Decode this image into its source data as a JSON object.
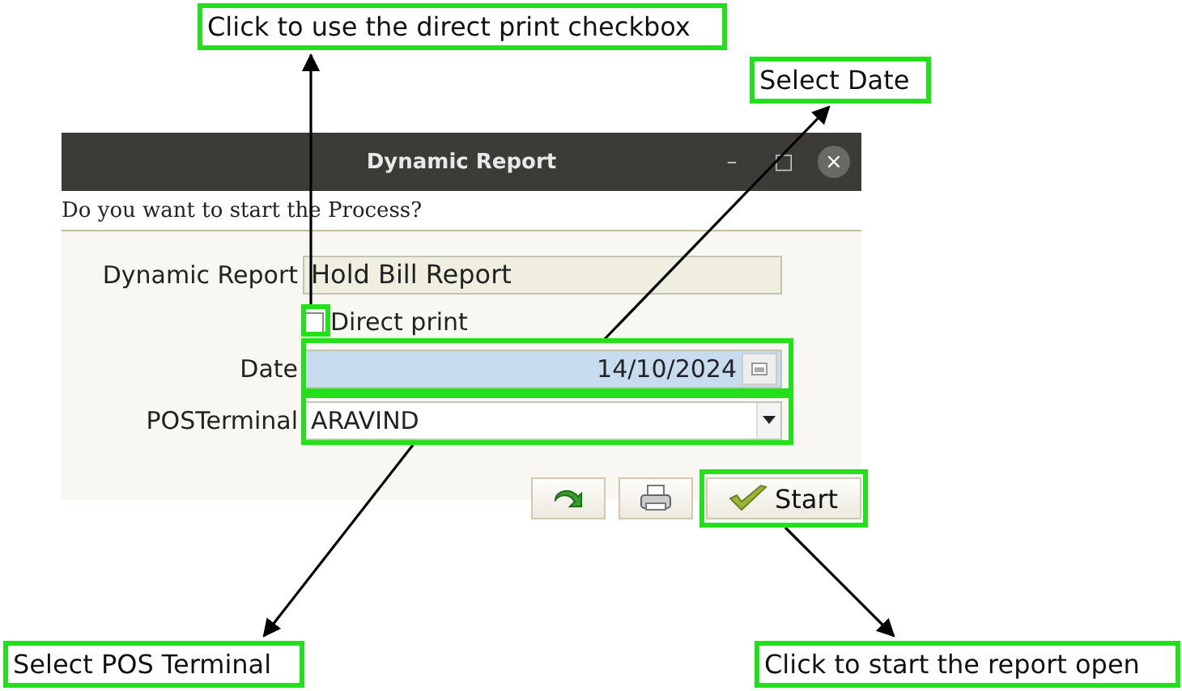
{
  "window": {
    "title": "Dynamic Report",
    "controls": [
      "–",
      "□",
      "×"
    ]
  },
  "message": "Do you want to start the Process?",
  "form": {
    "report_label": "Dynamic Report",
    "report_value": "Hold Bill Report",
    "direct_print": {
      "label": "Direct print",
      "checked": false
    },
    "date_label": "Date",
    "date_value": "14/10/2024",
    "pos_label": "POSTerminal",
    "pos_value": "ARAVIND"
  },
  "buttons": [
    {
      "kind": "refresh"
    },
    {
      "kind": "print"
    },
    {
      "kind": "start",
      "label": "Start"
    }
  ],
  "annotations": [
    {
      "text": "Click to use the direct print checkbox"
    },
    {
      "text": "Select Date"
    },
    {
      "text": "Select POS Terminal"
    },
    {
      "text": "Click to start the report open"
    }
  ]
}
